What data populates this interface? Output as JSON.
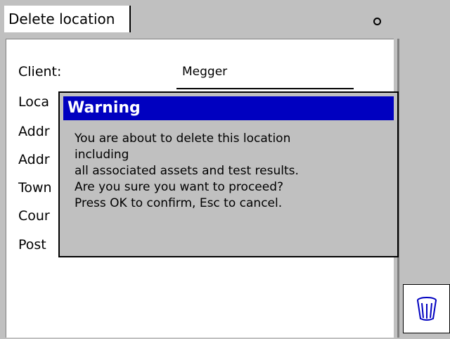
{
  "header": {
    "title": "Delete location"
  },
  "form": {
    "rows": [
      {
        "label": "Client:"
      },
      {
        "label": "Loca"
      },
      {
        "label": "Addr"
      },
      {
        "label": "Addr"
      },
      {
        "label": "Town"
      },
      {
        "label": "Cour"
      },
      {
        "label": "Post"
      }
    ],
    "client_value": "Megger"
  },
  "dialog": {
    "title": "Warning",
    "lines": [
      "You are about to delete this location",
      "including",
      "all associated assets and test results.",
      "Are you sure you want to proceed?",
      "Press OK to confirm, Esc to cancel."
    ]
  },
  "icons": {
    "delete": "trash-icon",
    "status": "status-dot-icon"
  }
}
